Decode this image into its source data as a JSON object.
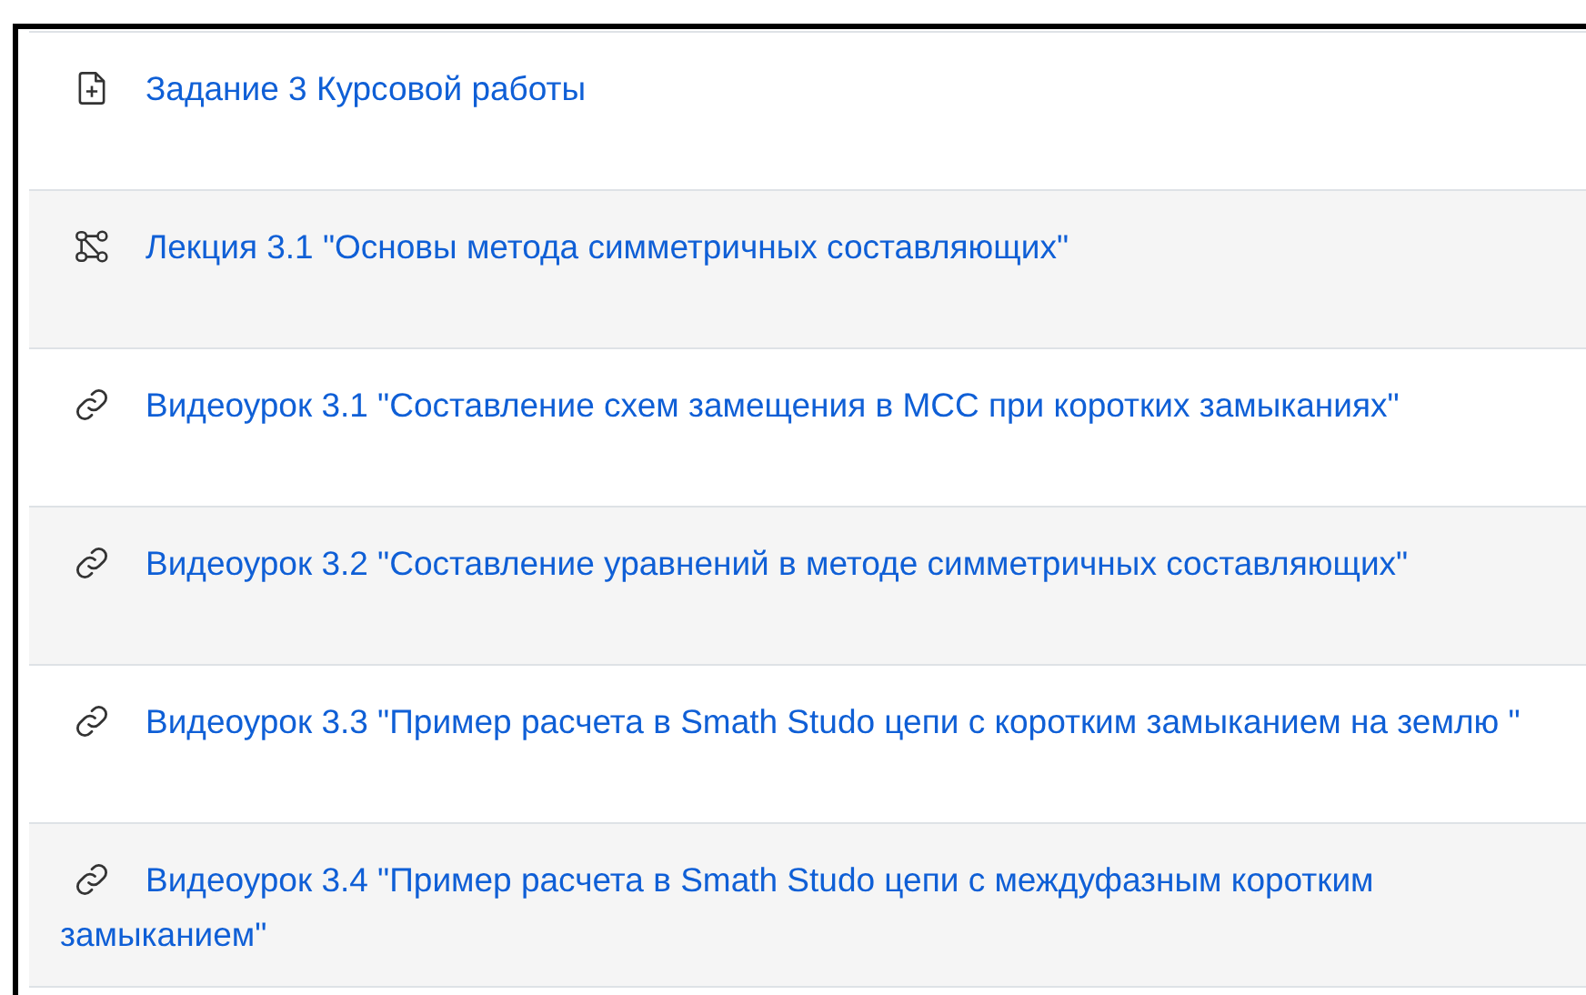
{
  "activities": [
    {
      "kind": "assignment",
      "title": "Задание 3 Курсовой работы"
    },
    {
      "kind": "lesson",
      "title": "Лекция 3.1 \"Основы метода симметричных составляющих\""
    },
    {
      "kind": "url",
      "title": "Видеоурок 3.1 \"Составление схем замещения в МСС при коротких замыканиях\""
    },
    {
      "kind": "url",
      "title": "Видеоурок 3.2 \"Составление уравнений в методе симметричных составляющих\""
    },
    {
      "kind": "url",
      "title": "Видеоурок 3.3 \"Пример расчета в Smath Studo цепи с коротким замыканием на землю \""
    },
    {
      "kind": "url",
      "title": "Видеоурок 3.4 \"Пример расчета в Smath Studo цепи с междуфазным коротким замыканием\""
    }
  ]
}
